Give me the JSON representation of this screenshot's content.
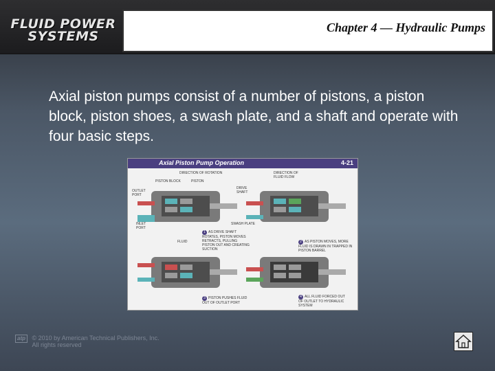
{
  "header": {
    "logo_line1": "FLUID POWER",
    "logo_line2": "SYSTEMS",
    "chapter_title": "Chapter 4 — Hydraulic Pumps"
  },
  "content": {
    "body_text": "Axial piston pumps consist of a number of pistons, a piston block, piston shoes, a swash plate, and a shaft and operate with four basic steps."
  },
  "figure": {
    "title": "Axial Piston Pump Operation",
    "number": "4-21",
    "labels": {
      "direction_rotation": "DIRECTION OF ROTATION",
      "piston_block": "PISTON BLOCK",
      "piston": "PISTON",
      "outlet_port": "OUTLET PORT",
      "drive_shaft": "DRIVE SHAFT",
      "swash_plate": "SWASH PLATE",
      "inlet_port": "INLET PORT",
      "fluid": "FLUID",
      "direction_flow": "DIRECTION OF FLUID FLOW"
    },
    "steps": [
      {
        "num": "1",
        "text": "AS DRIVE SHAFT ROTATES, PISTON MOVES RETRACTS, PULLING PISTON OUT AND CREATING SUCTION"
      },
      {
        "num": "2",
        "text": "AS PISTON MOVES, MORE FLUID IS DRAWN IN TRAPPED IN PISTON BARREL"
      },
      {
        "num": "3",
        "text": "PISTON PUSHES FLUID OUT OF OUTLET PORT"
      },
      {
        "num": "4",
        "text": "ALL FLUID FORCED OUT OF OUTLET TO HYDRAULIC SYSTEM"
      }
    ]
  },
  "footer": {
    "logo": "atp",
    "copyright_line1": "© 2010 by American Technical Publishers, Inc.",
    "copyright_line2": "All rights reserved"
  },
  "colors": {
    "banner": "#1c1c1e",
    "background_mid": "#5b6c7e",
    "figure_header": "#4a3f80",
    "body_text": "#ffffff"
  }
}
